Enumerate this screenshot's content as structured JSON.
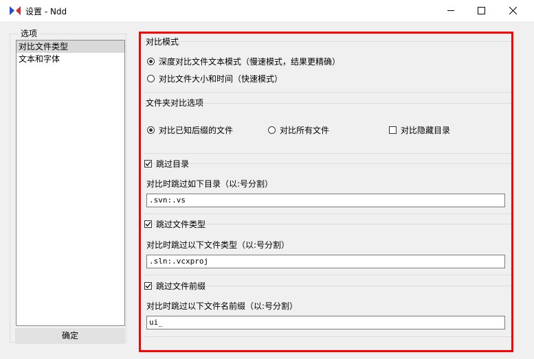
{
  "window": {
    "title": "设置 - Ndd",
    "icons": {
      "app": "notepad-app-icon",
      "minimize": "minimize-icon",
      "maximize": "maximize-icon",
      "close": "close-icon"
    }
  },
  "sidebar": {
    "legend": "选项",
    "items": [
      {
        "label": "对比文件类型",
        "selected": true
      },
      {
        "label": "文本和字体",
        "selected": false
      }
    ],
    "ok_label": "确定"
  },
  "compare_mode": {
    "title": "对比模式",
    "options": [
      {
        "label": "深度对比文件文本模式（慢速模式，结果更精确）",
        "checked": true
      },
      {
        "label": "对比文件大小和时间（快速模式）",
        "checked": false
      }
    ]
  },
  "folder_compare": {
    "title": "文件夹对比选项",
    "known_suffix": {
      "label": "对比已知后缀的文件",
      "checked": true
    },
    "all_files": {
      "label": "对比所有文件",
      "checked": false
    },
    "hidden_dirs": {
      "label": "对比隐藏目录",
      "checked": false
    }
  },
  "skip_dirs": {
    "label": "跳过目录",
    "checked": true,
    "desc": "对比时跳过如下目录（以:号分割）",
    "value": ".svn:.vs"
  },
  "skip_types": {
    "label": "跳过文件类型",
    "checked": true,
    "desc": "对比时跳过以下文件类型（以:号分割）",
    "value": ".sln:.vcxproj"
  },
  "skip_prefix": {
    "label": "跳过文件前缀",
    "checked": true,
    "desc": "对比时跳过以下文件名前缀（以:号分割）",
    "value": "ui_"
  },
  "colors": {
    "highlight_frame": "#ff0000",
    "window_bg": "#f0f0f0",
    "selection": "#d9d9d9"
  }
}
